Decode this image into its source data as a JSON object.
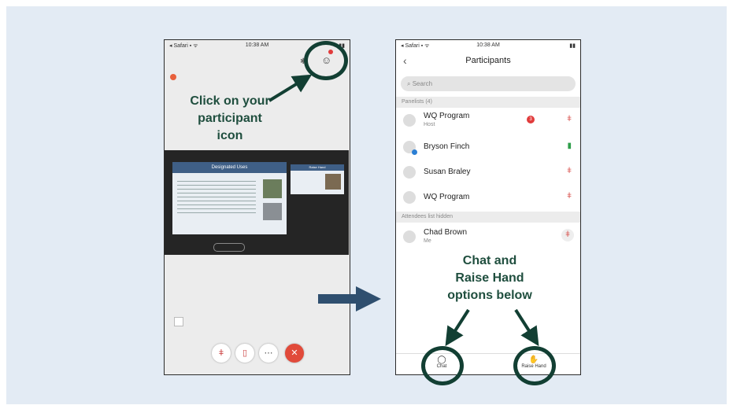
{
  "left_phone": {
    "status_left": "◂ Safari ▪ ᯤ",
    "status_time": "10:38 AM",
    "status_right": "▮▮",
    "callout": [
      "Click on your",
      "participant",
      "icon"
    ],
    "slide_title": "Designated Uses",
    "thumb_title": "Raise Hand",
    "bottom_controls": [
      "mute-mic",
      "stop-video",
      "more",
      "leave"
    ]
  },
  "right_phone": {
    "status_left": "◂ Safari ▪ ᯤ",
    "status_time": "10:38 AM",
    "status_right": "▮▮",
    "title": "Participants",
    "search_placeholder": "Search",
    "panelists_header": "Panelists (4)",
    "panelists": [
      {
        "name": "WQ Program",
        "sub": "Host",
        "badge": "3",
        "mic": "muted"
      },
      {
        "name": "Bryson Finch",
        "sub": "",
        "badge": "",
        "mic": "active"
      },
      {
        "name": "Susan Braley",
        "sub": "",
        "badge": "",
        "mic": "muted"
      },
      {
        "name": "WQ Program",
        "sub": "",
        "badge": "",
        "mic": "muted"
      }
    ],
    "attendees_header": "Attendees list hidden",
    "attendee": {
      "name": "Chad Brown",
      "sub": "Me",
      "mic": "muted"
    },
    "callout": [
      "Chat and",
      "Raise Hand",
      "options below"
    ],
    "chat_label": "Chat",
    "raise_label": "Raise Hand"
  },
  "colors": {
    "accent": "#123f33",
    "callout_text": "#1f4e3e",
    "arrow": "#2f4f6f",
    "panel_bg": "#e3ebf4"
  }
}
